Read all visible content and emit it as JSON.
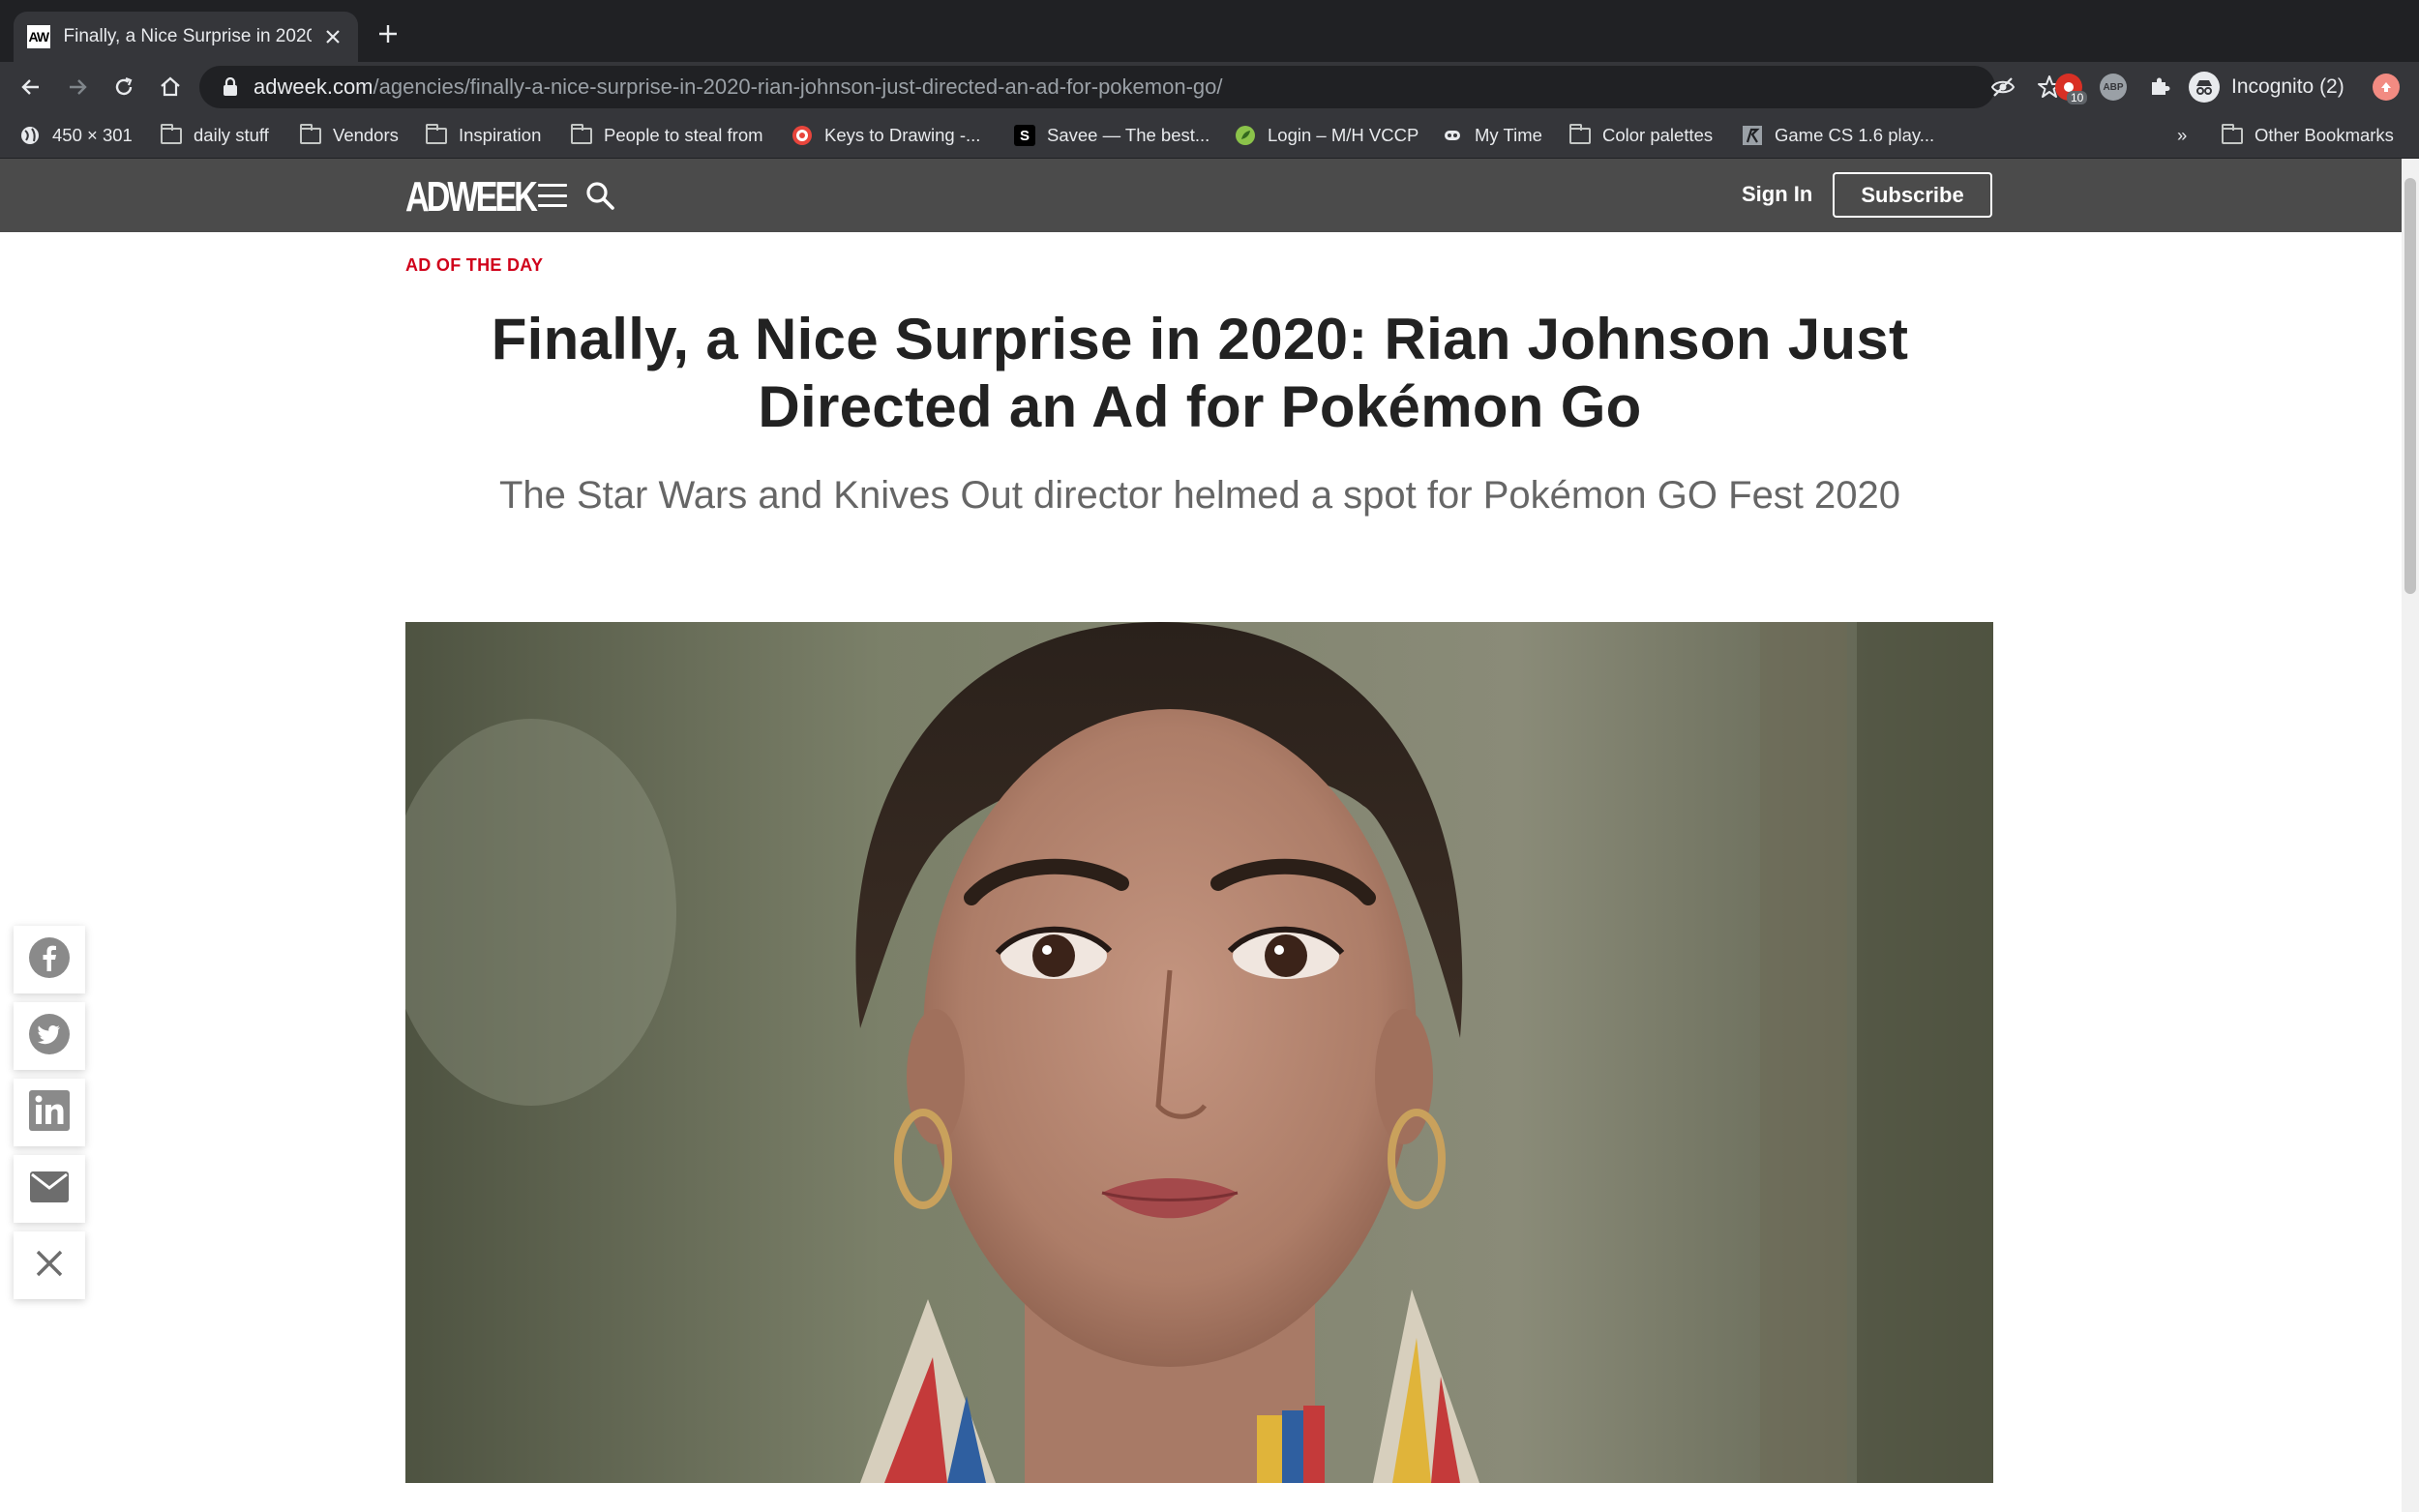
{
  "browser": {
    "tab_title": "Finally, a Nice Surprise in 2020",
    "tab_favicon": "AW",
    "url_host": "adweek.com",
    "url_path": "/agencies/finally-a-nice-surprise-in-2020-rian-johnson-just-directed-an-ad-for-pokemon-go/",
    "profile_label": "Incognito (2)",
    "extension_badge": "10",
    "bookmarks": [
      {
        "label": "450 × 301",
        "icon": "globe-icon"
      },
      {
        "label": "daily stuff",
        "icon": "folder-icon"
      },
      {
        "label": "Vendors",
        "icon": "folder-icon"
      },
      {
        "label": "Inspiration",
        "icon": "folder-icon"
      },
      {
        "label": "People to steal from",
        "icon": "folder-icon"
      },
      {
        "label": "Keys to Drawing -...",
        "icon": "target-icon"
      },
      {
        "label": "Savee — The best...",
        "icon": "savee-icon"
      },
      {
        "label": "Login – M/H VCCP",
        "icon": "leaf-icon"
      },
      {
        "label": "My Time",
        "icon": "mask-icon"
      },
      {
        "label": "Color palettes",
        "icon": "folder-icon"
      },
      {
        "label": "Game CS 1.6 play...",
        "icon": "game-icon"
      }
    ],
    "bookmarks_overflow": "»",
    "other_bookmarks": "Other Bookmarks"
  },
  "site": {
    "logo": "ADWEEK",
    "sign_in": "Sign In",
    "subscribe": "Subscribe"
  },
  "article": {
    "kicker": "AD OF THE DAY",
    "headline": "Finally, a Nice Surprise in 2020: Rian Johnson Just Directed an Ad for Pokémon Go",
    "dek": "The Star Wars and Knives Out director helmed a spot for Pokémon GO Fest 2020"
  },
  "share_bar": [
    "facebook-icon",
    "twitter-icon",
    "linkedin-icon",
    "email-icon",
    "close-icon"
  ],
  "colors": {
    "kicker": "#d0021b",
    "site_header": "#4b4b4b",
    "browser_frame": "#202124",
    "browser_toolbar": "#35363a"
  }
}
